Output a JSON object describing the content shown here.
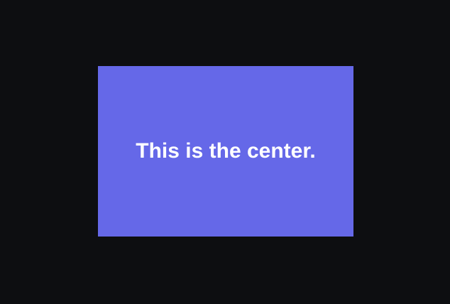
{
  "app": {
    "background_color": "#0d0e11"
  },
  "content": {
    "box_color": "#6568e8",
    "text_color": "#ffffff",
    "message": "This is the center."
  }
}
